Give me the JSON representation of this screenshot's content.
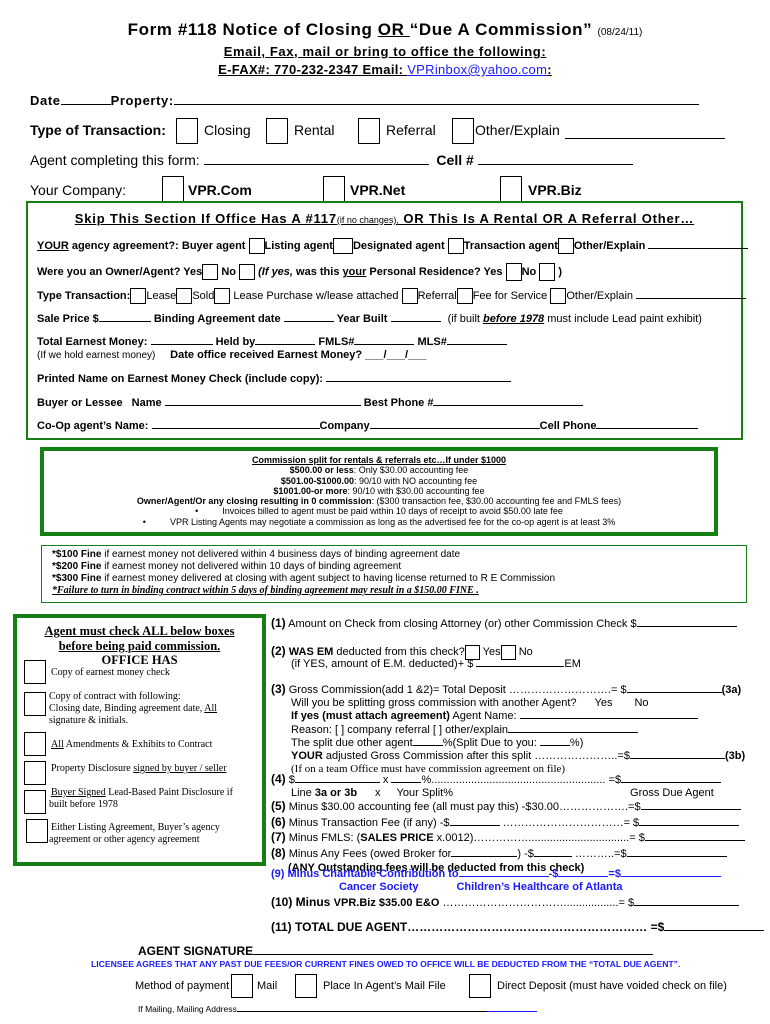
{
  "header": {
    "title": "Form #118 Notice of Closing ",
    "title_or": "OR ",
    "title_rest": "“Due A Commission”",
    "revision": "(08/24/11)",
    "instructions": "Email, Fax, mail or bring to office the following:",
    "efax_label": "E-FAX#: 770-232-2347 Email: ",
    "email": "VPRinbox@yahoo.com",
    "email_suffix": ":"
  },
  "top": {
    "date_label": "Date",
    "property_label": "Property:",
    "type_label": "Type of Transaction:",
    "type_options": [
      "Closing",
      "Rental",
      "Referral",
      "Other/Explain"
    ],
    "agent_label": "Agent completing this form:",
    "cell_label": "Cell #",
    "company_label": "Your Company:",
    "company_options": [
      "VPR.Com",
      "VPR.Net",
      "VPR.Biz"
    ]
  },
  "skip_section": {
    "heading": "Skip This Section If Office Has A #117",
    "heading_small": "(if no changes),",
    "heading_rest": " OR This Is A Rental OR A Referral Other…",
    "agency_prefix": "YOUR",
    "agency_label": " agency agreement?: Buyer agent",
    "agency_options": [
      "Listing agent",
      "Designated agent",
      "Transaction agent",
      "Other/Explain"
    ],
    "owner_label": "Were you an Owner/Agent? Yes",
    "owner_no": "No",
    "owner_if": "(If yes,",
    "owner_was": " was this ",
    "owner_your": "your",
    "owner_personal": " Personal Residence? Yes",
    "owner_no2": "No",
    "owner_close": ")",
    "type_label": "Type Transaction:",
    "type_options": [
      "Lease",
      "Sold",
      "Lease Purchase w/lease attached",
      "Referral",
      "Fee for Service",
      "Other/Explain"
    ],
    "sale_price": "Sale Price $",
    "binding_date": "Binding Agreement date",
    "year_built": "Year Built",
    "lead_note_a": "(if built ",
    "lead_note_b": "before 1978",
    "lead_note_c": " must include Lead paint exhibit)",
    "earnest_total": "Total Earnest Money:",
    "held_by": "Held by",
    "fmls": "FMLS#",
    "mls": "MLS#",
    "if_we_hold": "(If we hold earnest money)",
    "date_received": "Date office received Earnest Money? ___/___/___",
    "printed_name": "Printed Name on Earnest Money Check (include copy):",
    "buyer_lessee": "Buyer or Lessee",
    "name_label": "Name",
    "best_phone": "Best Phone #",
    "coop_name": "Co-Op agent’s Name:",
    "company_label": "Company",
    "cell_phone": "Cell Phone"
  },
  "commission_box": {
    "heading": "Commission split for rentals & referrals etc…If under $1000",
    "rows": [
      {
        "bold": "$500.00 or less",
        "text": ": Only $30.00 accounting fee"
      },
      {
        "bold": "$501.00-$1000.00",
        "text": ": 90/10 with NO accounting fee"
      },
      {
        "bold": "$1001.00-or more",
        "text": ": 90/10 with $30.00 accounting fee"
      },
      {
        "bold": "Owner/Agent/Or any closing resulting in 0 commission",
        "text": ": ($300 transaction fee, $30.00 accounting fee and FMLS fees)"
      }
    ],
    "bullets": [
      "Invoices billed to agent must be paid within 10 days of receipt to avoid $50.00 late fee",
      "VPR Listing Agents may negotiate a commission as long as the advertised fee for the co-op agent is at least 3%"
    ]
  },
  "fines": [
    {
      "bold": "*$100 Fine",
      "text": " if earnest money not delivered within 4 business days of binding agreement date"
    },
    {
      "bold": "*$200 Fine",
      "text": " if earnest money not delivered within 10 days of binding agreement"
    },
    {
      "bold": "*$300 Fine",
      "text": " if earnest money delivered at closing with agent subject to having license returned to R E Commission"
    }
  ],
  "fines_footer": "*Failure to turn in binding contract within 5 days of binding agreement may result in a $150.00 FINE .",
  "checklist": {
    "heading1": "Agent must check ALL below boxes",
    "heading2": "before being paid commission.",
    "heading3": "OFFICE HAS",
    "items": [
      {
        "pre": "",
        "u": "",
        "text": "Copy of earnest money check"
      },
      {
        "pre": "",
        "u": "",
        "text": "Copy of contract with following:"
      },
      {
        "pre": "",
        "u": "All",
        "text": " Amendments & Exhibits to Contract"
      },
      {
        "pre": "Property Disclosure ",
        "u": "signed by buyer / seller",
        "text": ""
      },
      {
        "pre": "",
        "u": "Buyer Signed",
        "text": "  Lead-Based Paint Disclosure if"
      },
      {
        "pre": "",
        "u": "",
        "text": "Either Listing Agreement, Buyer’s agency"
      }
    ],
    "item2_line2a": "Closing date, Binding agreement date, ",
    "item2_line2u": "All",
    "item2_line3": "signature & initials.",
    "item5_line2": "built before 1978",
    "item6_line2": "agreement or other agency agreement"
  },
  "calc": {
    "l1_num": "(1)",
    "l1": " Amount on Check from closing Attorney (or) other Commission Check $",
    "l2_num": "(2)",
    "l2_bold": " WAS EM",
    "l2": " deducted from this check?",
    "l2_yes": "Yes",
    "l2_no": "No",
    "l2b": "(if YES, amount of E.M. deducted)+ $",
    "l2b_em": "EM",
    "l3_num": "(3)",
    "l3": " Gross Commission(add 1 &2)= Total Deposit ……………………….= $",
    "l3_tag": "(3a)",
    "l3_split": "Will you be splitting gross commission with another Agent?",
    "l3_yes": "Yes",
    "l3_no": "No",
    "l3_ifyes_bold": "If yes (must attach agreement)",
    "l3_ifyes": " Agent Name:",
    "l3_reason": "Reason: [  ] company referral [  ] other/explain",
    "l3_split_due": "The split due other agent",
    "l3_split_due_b": "%(Split Due to you: ",
    "l3_split_due_c": "%)",
    "l3_your_bold": "YOUR",
    "l3_your": " adjusted Gross Commission after this split …………………..=$",
    "l3_tag_b": "(3b)",
    "l3_team": "(If on a team Office must have commission agreement on file)",
    "l4_num": "(4)",
    "l4": " $",
    "l4_x": " x ",
    "l4_pct": "%......................................................... =$",
    "l4_line": "Line ",
    "l4_line_b": "3a or 3b",
    "l4_line_x": "x",
    "l4_split": "Your Split%",
    "l4_gross": "Gross Due Agent",
    "l5_num": "(5)",
    "l5": " Minus $30.00 accounting fee (all must pay this) -$30.00……………….=$",
    "l6_num": "(6)",
    "l6": " Minus Transaction Fee (if any) -$",
    "l6_b": " ……………………………= $",
    "l7_num": "(7)",
    "l7": " Minus FMLS: (",
    "l7_bold": "SALES PRICE",
    "l7_b": " x.0012)…………….................................= $",
    "l8_num": "(8)",
    "l8": " Minus Any Fees (owed Broker for",
    "l8_b": ") -$",
    "l8_c": "  ………..=$",
    "l8_note": "(ANY Outstanding fees will be deducted from this check)",
    "l9": "(9) Minus Charitable Contribution to",
    "l9_b": "-$",
    "l9_c": "=$",
    "l9_cancer": "Cancer Society",
    "l9_childrens": "Children’s Healthcare of Atlanta",
    "l10": "(10) Minus ",
    "l10_b": "VPR.Biz $35.00 E&O",
    "l10_c": " ……………………………..................= $",
    "l11": "(11) TOTAL DUE AGENT…………………………………………………… =$"
  },
  "footer": {
    "signature": "AGENT SIGNATURE",
    "licensee": "LICENSEE AGREES THAT ANY PAST DUE FEES/OR CURRENT FINES OWED TO OFFICE WILL BE DEDUCTED FROM THE “TOTAL DUE AGENT”.",
    "method_label": "Method of payment",
    "methods": [
      "Mail",
      "Place In Agent’s Mail File",
      "Direct Deposit (must have voided check on file)"
    ],
    "mailing": "If Mailing, Mailing Address"
  },
  "colors": {
    "border_green": "#148014",
    "link_blue": "#1a1aff"
  }
}
